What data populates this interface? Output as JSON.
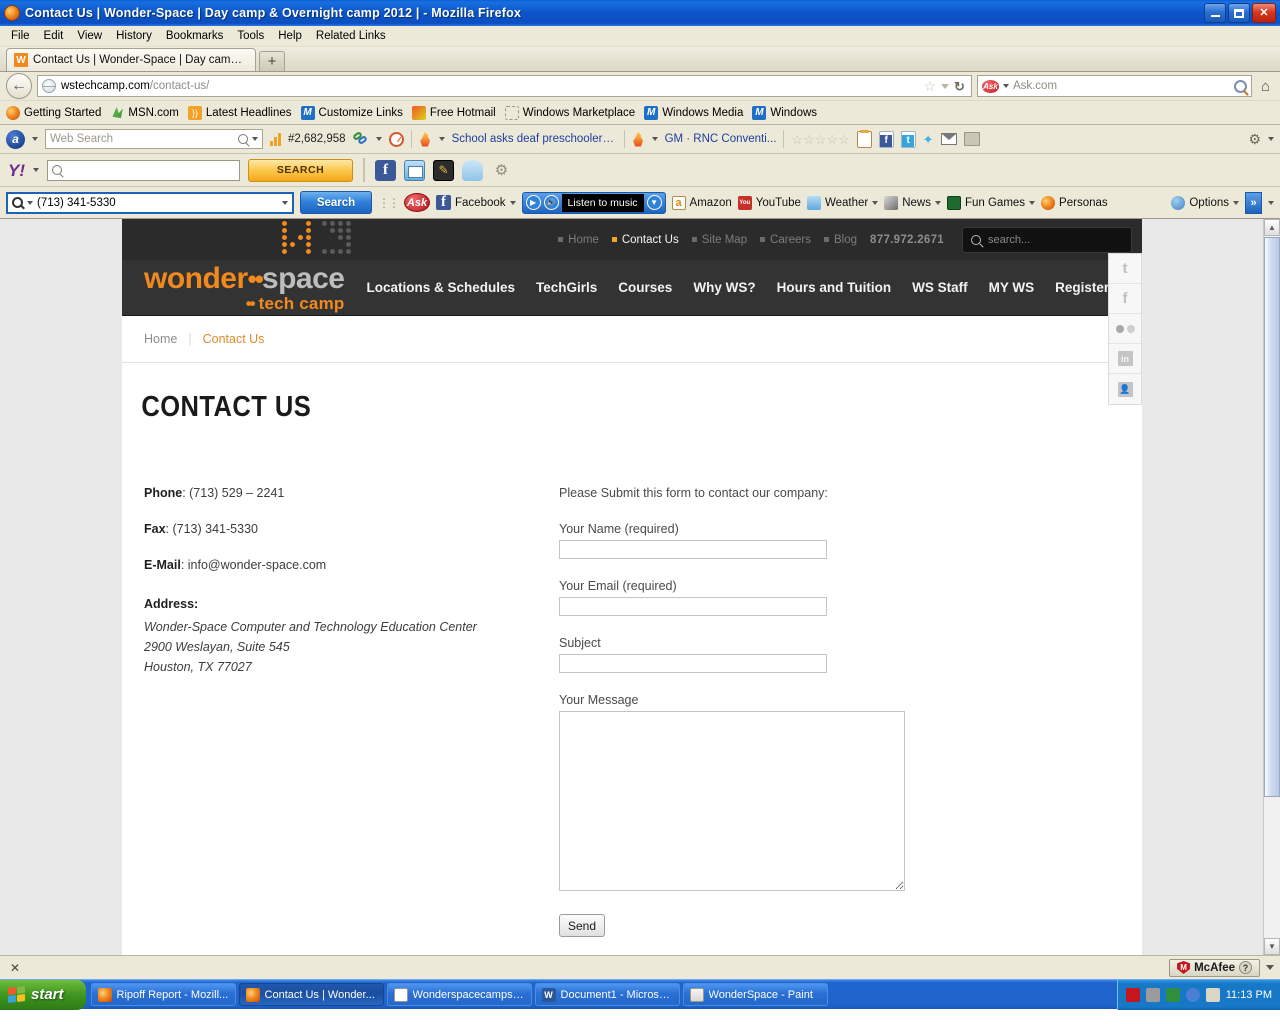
{
  "window": {
    "title": "Contact Us  |  Wonder-Space  |  Day camp & Overnight camp 2012  |  - Mozilla Firefox",
    "minimize": "–",
    "maximize": "□",
    "close": "✕"
  },
  "menubar": [
    "File",
    "Edit",
    "View",
    "History",
    "Bookmarks",
    "Tools",
    "Help",
    "Related Links"
  ],
  "tab": {
    "favicon_letter": "W",
    "label": "Contact Us | Wonder-Space | Day camp & O...",
    "new_tab": "+"
  },
  "urlbar": {
    "back": "←",
    "url_host": "wstechcamp.com",
    "url_path": "/contact-us/",
    "star": "☆",
    "reload": "↻",
    "home": "⌂"
  },
  "browser_search": {
    "engine": "Ask",
    "placeholder": "Ask.com"
  },
  "bookmarks": [
    {
      "label": "Getting Started",
      "icon": "firefox-icon"
    },
    {
      "label": "MSN.com",
      "icon": "msn-icon"
    },
    {
      "label": "Latest Headlines",
      "icon": "rss-icon"
    },
    {
      "label": "Customize Links",
      "icon": "msn-blue-icon"
    },
    {
      "label": "Free Hotmail",
      "icon": "hotmail-icon"
    },
    {
      "label": "Windows Marketplace",
      "icon": "placeholder-icon"
    },
    {
      "label": "Windows Media",
      "icon": "msn-blue-icon"
    },
    {
      "label": "Windows",
      "icon": "msn-blue-icon"
    }
  ],
  "alexa_toolbar": {
    "logo": "a",
    "search_placeholder": "Web Search",
    "rank": "#2,682,958",
    "news_link": "School asks deaf preschooler t...",
    "news_link2": "GM · RNC Conventi...",
    "stars": "☆☆☆☆☆",
    "gear": "⚙"
  },
  "yahoo_toolbar": {
    "logo": "Y!",
    "search_value": "",
    "search_button": "SEARCH",
    "gear": "⚙"
  },
  "ask_toolbar": {
    "search_value": "(713) 341-5330",
    "search_button": "Search",
    "ask_logo": "Ask",
    "facebook": "Facebook",
    "music_label": "Listen to music",
    "items": [
      {
        "label": "Amazon",
        "icon": "amazon-icon"
      },
      {
        "label": "YouTube",
        "icon": "youtube-icon"
      },
      {
        "label": "Weather",
        "icon": "weather-icon"
      },
      {
        "label": "News",
        "icon": "news-icon"
      },
      {
        "label": "Fun Games",
        "icon": "games-icon"
      },
      {
        "label": "Personas",
        "icon": "firefox-icon"
      }
    ],
    "options": "Options",
    "overflow": "»"
  },
  "site": {
    "top_nav": [
      {
        "label": "Home",
        "active": false
      },
      {
        "label": "Contact Us",
        "active": true
      },
      {
        "label": "Site Map",
        "active": false
      },
      {
        "label": "Careers",
        "active": false
      },
      {
        "label": "Blog",
        "active": false
      }
    ],
    "phone_header": "877.972.2671",
    "search_placeholder": "search...",
    "brand": {
      "word1": "wonder",
      "dots": "••",
      "word2": "space",
      "tagline": "tech camp"
    },
    "main_nav": [
      "Locations & Schedules",
      "TechGirls",
      "Courses",
      "Why WS?",
      "Hours and Tuition",
      "WS Staff",
      "MY WS",
      "Register"
    ],
    "breadcrumb": {
      "home": "Home",
      "sep": "|",
      "current": "Contact Us"
    },
    "page_title": "CONTACT US",
    "contact": {
      "phone_label": "Phone",
      "phone_value": ": (713) 529 – 2241",
      "fax_label": "Fax",
      "fax_value": ": (713) 341-5330",
      "email_label": "E-Mail",
      "email_value": ": info@wonder-space.com",
      "address_label": "Address:",
      "address_line1": "Wonder-Space Computer and Technology Education Center",
      "address_line2": "2900 Weslayan, Suite 545",
      "address_line3": "Houston, TX 77027"
    },
    "form": {
      "intro": "Please Submit this form to contact our company:",
      "name_label": "Your Name (required)",
      "name_value": "",
      "email_label": "Your Email (required)",
      "email_value": "",
      "subject_label": "Subject",
      "subject_value": "",
      "message_label": "Your Message",
      "message_value": "",
      "send_label": "Send"
    },
    "social": [
      {
        "name": "twitter",
        "glyph": "t"
      },
      {
        "name": "facebook",
        "glyph": "f"
      },
      {
        "name": "flickr",
        "glyph": ""
      },
      {
        "name": "linkedin",
        "glyph": "in"
      },
      {
        "name": "share",
        "glyph": ""
      }
    ]
  },
  "statusbar": {
    "close": "✕",
    "mcafee": "McAfee",
    "question": "?"
  },
  "taskbar": {
    "start": "start",
    "tasks": [
      {
        "label": "Ripoff Report - Mozill...",
        "icon": "firefox-icon",
        "active": false
      },
      {
        "label": "Contact Us | Wonder...",
        "icon": "firefox-icon",
        "active": true
      },
      {
        "label": "Wonderspacecampsm...",
        "icon": "notepad-icon",
        "active": false
      },
      {
        "label": "Document1 - Microsof...",
        "icon": "word-icon",
        "active": false
      },
      {
        "label": "WonderSpace - Paint",
        "icon": "paint-icon",
        "active": false
      }
    ],
    "clock": "11:13 PM"
  }
}
